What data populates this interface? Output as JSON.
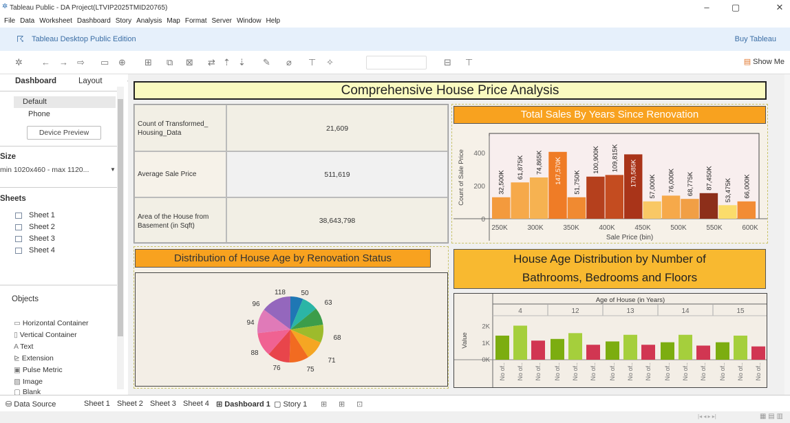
{
  "window": {
    "title": "Tableau Public - DA Project(LTVIP2025TMID20765)",
    "min": "–",
    "max": "▢",
    "close": "✕"
  },
  "menu": [
    "File",
    "Data",
    "Worksheet",
    "Dashboard",
    "Story",
    "Analysis",
    "Map",
    "Format",
    "Server",
    "Window",
    "Help"
  ],
  "edition": {
    "label": "Tableau Desktop Public Edition",
    "buy": "Buy Tableau"
  },
  "toolbar": {
    "show_me": "Show Me"
  },
  "left_panel": {
    "tabs": [
      "Dashboard",
      "Layout"
    ],
    "device": {
      "default": "Default",
      "phone": "Phone",
      "preview_button": "Device Preview"
    },
    "size": {
      "heading": "Size",
      "value": "min 1020x460 - max 1120..."
    },
    "sheets": {
      "heading": "Sheets",
      "items": [
        "Sheet 1",
        "Sheet 2",
        "Sheet 3",
        "Sheet 4"
      ]
    },
    "objects": {
      "heading": "Objects",
      "items": [
        "Horizontal Container",
        "Vertical Container",
        "Text",
        "Extension",
        "Pulse Metric",
        "Image",
        "Blank"
      ]
    }
  },
  "dashboard": {
    "title": "Comprehensive House Price Analysis",
    "kpis": [
      {
        "label": "Count of Transformed_ Housing_Data",
        "value": "21,609"
      },
      {
        "label": "Average Sale Price",
        "value": "511,619"
      },
      {
        "label": "Area of the House from Basement (in Sqft)",
        "value": "38,643,798"
      }
    ],
    "sales_title": "Total Sales By Years Since Renovation",
    "pie_title": "Distribution of House Age by Renovation Status",
    "age_title_1": "House Age Distribution by Number of",
    "age_title_2": "Bathrooms, Bedrooms and Floors"
  },
  "chart_data": [
    {
      "type": "bar",
      "title": "Total Sales By Years Since Renovation",
      "xlabel": "Sale Price (bin)",
      "ylabel": "Count of Sale Price",
      "ylim": [
        0,
        500
      ],
      "yticks": [
        "0",
        "200",
        "400"
      ],
      "xticks": [
        "250K",
        "300K",
        "350K",
        "400K",
        "450K",
        "500K",
        "550K",
        "600K"
      ],
      "bar_labels": [
        "32,500K",
        "61,875K",
        "74,865K",
        "147,570K",
        "51,750K",
        "100,900K",
        "109,815K",
        "170,585K",
        "57,000K",
        "76,000K",
        "68,775K",
        "87,450K",
        "53,475K",
        "66,000K"
      ],
      "values": [
        130,
        220,
        250,
        405,
        130,
        255,
        265,
        390,
        105,
        140,
        120,
        155,
        82,
        105
      ],
      "colors": [
        "#f39a3d",
        "#f6a94a",
        "#f6b251",
        "#ef7c26",
        "#f08a31",
        "#b5401d",
        "#c44c20",
        "#a93419",
        "#f9c865",
        "#f6a94a",
        "#f19f45",
        "#8d2f1a",
        "#fbdc6b",
        "#f28c35"
      ]
    },
    {
      "type": "pie",
      "title": "Distribution of House Age by Renovation Status",
      "labels": [
        "50",
        "63",
        "68",
        "71",
        "75",
        "76",
        "88",
        "94",
        "96",
        "118"
      ],
      "values": [
        50,
        63,
        68,
        71,
        75,
        76,
        88,
        94,
        96,
        118
      ],
      "colors": [
        "#1f77b4",
        "#2bb5a6",
        "#3c9d4a",
        "#9dbb2c",
        "#f5a623",
        "#f26b21",
        "#e8454b",
        "#f06292",
        "#e07ab8",
        "#9467bd"
      ]
    },
    {
      "type": "bar",
      "title": "House Age Distribution by Number of Bathrooms, Bedrooms and Floors",
      "header": "Age of House (in Years)",
      "ylabel": "Value",
      "yticks": [
        "0K",
        "1K",
        "2K"
      ],
      "columns": [
        "4",
        "12",
        "13",
        "14",
        "15"
      ],
      "bar_label": "No of..",
      "series": [
        {
          "values": [
            1.45,
            1.25,
            1.1,
            1.05,
            1.05
          ],
          "color": "#7cad10"
        },
        {
          "values": [
            2.05,
            1.6,
            1.5,
            1.5,
            1.45
          ],
          "color": "#a5cf3c"
        },
        {
          "values": [
            1.15,
            0.9,
            0.9,
            0.85,
            0.8
          ],
          "color": "#d13652"
        }
      ]
    }
  ],
  "bottom_tabs": [
    "Data Source",
    "Sheet 1",
    "Sheet 2",
    "Sheet 3",
    "Sheet 4",
    "Dashboard 1",
    "Story 1"
  ]
}
